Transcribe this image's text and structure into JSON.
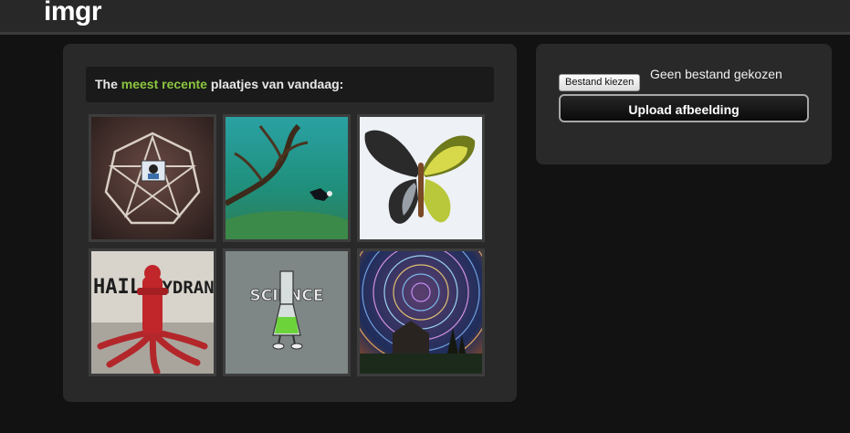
{
  "header": {
    "logo": "imgr"
  },
  "gallery": {
    "heading_prefix": "The ",
    "heading_accent": "meest recente",
    "heading_suffix": " plaatjes van vandaag:",
    "accent_color": "#8cc63f",
    "thumbnails": [
      {
        "subject": "pentagram"
      },
      {
        "subject": "underwater-diver"
      },
      {
        "subject": "butterfly"
      },
      {
        "subject": "hail-hydrant"
      },
      {
        "subject": "science-flask",
        "text": "SCIENCE"
      },
      {
        "subject": "star-trails"
      }
    ],
    "hydrant_text_left": "HAIL",
    "hydrant_text_right": "HYDRANT"
  },
  "upload": {
    "choose_file_label": "Bestand kiezen",
    "file_status": "Geen bestand gekozen",
    "upload_label": "Upload afbeelding"
  }
}
